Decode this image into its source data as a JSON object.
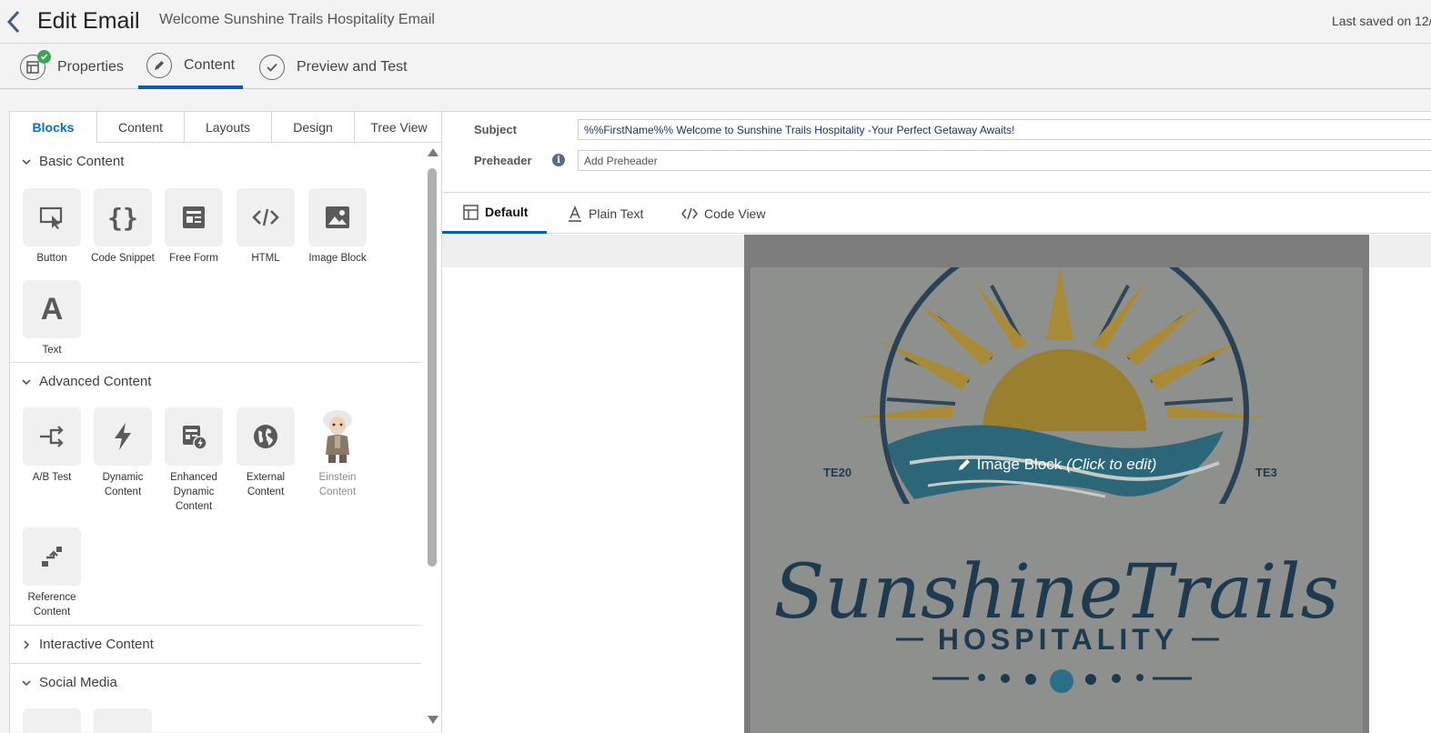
{
  "header": {
    "title": "Edit Email",
    "email_name": "Welcome Sunshine Trails Hospitality Email",
    "last_saved": "Last saved on 12/"
  },
  "steps": [
    {
      "label": "Properties",
      "icon": "properties-icon",
      "completed": true
    },
    {
      "label": "Content",
      "icon": "pencil-icon",
      "active": true
    },
    {
      "label": "Preview and Test",
      "icon": "check-icon"
    }
  ],
  "left_tabs": [
    "Blocks",
    "Content",
    "Layouts",
    "Design",
    "Tree View"
  ],
  "sections": {
    "basic": {
      "title": "Basic Content",
      "blocks": [
        "Button",
        "Code Snippet",
        "Free Form",
        "HTML",
        "Image Block",
        "Text"
      ]
    },
    "advanced": {
      "title": "Advanced Content",
      "blocks": [
        "A/B Test",
        "Dynamic Content",
        "Enhanced Dynamic Content",
        "External Content",
        "Einstein Content",
        "Reference Content"
      ]
    },
    "interactive": {
      "title": "Interactive Content"
    },
    "social": {
      "title": "Social Media"
    }
  },
  "subject": {
    "label": "Subject",
    "value": "%%FirstName%% Welcome to Sunshine Trails Hospitality -Your Perfect Getaway Awaits!"
  },
  "preheader": {
    "label": "Preheader",
    "placeholder": "Add Preheader",
    "info": "i"
  },
  "view_tabs": [
    "Default",
    "Plain Text",
    "Code View"
  ],
  "canvas": {
    "overlay_label": "Image Block",
    "overlay_hint": "(Click to edit)",
    "logo": {
      "brand_line1": "SunshineTrails",
      "brand_line2": "HOSPITALITY",
      "left_mark": "TE20",
      "right_mark": "TE3"
    }
  },
  "colors": {
    "accent": "#0b5cab",
    "logo_navy": "#1e3a4f",
    "logo_gold": "#b08d2e",
    "logo_teal": "#2b6f86"
  }
}
